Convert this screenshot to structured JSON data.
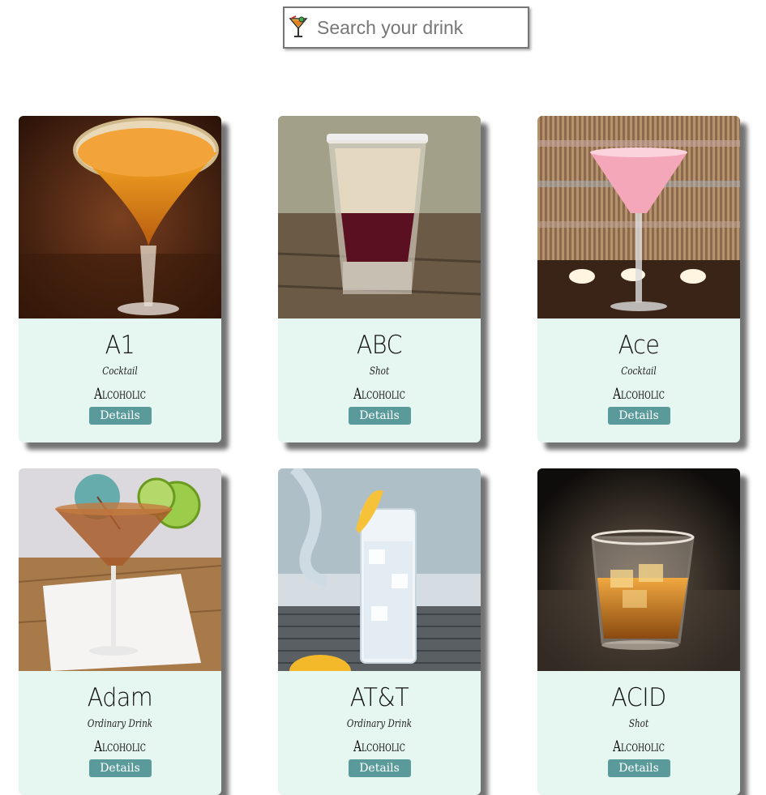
{
  "search": {
    "placeholder": "Search your drink",
    "icon": "cocktail-icon"
  },
  "drinks": [
    {
      "name": "A1",
      "category": "Cocktail",
      "alcoholic": "Alcoholic",
      "button": "Details"
    },
    {
      "name": "ABC",
      "category": "Shot",
      "alcoholic": "Alcoholic",
      "button": "Details"
    },
    {
      "name": "Ace",
      "category": "Cocktail",
      "alcoholic": "Alcoholic",
      "button": "Details"
    },
    {
      "name": "Adam",
      "category": "Ordinary Drink",
      "alcoholic": "Alcoholic",
      "button": "Details"
    },
    {
      "name": "AT&T",
      "category": "Ordinary Drink",
      "alcoholic": "Alcoholic",
      "button": "Details"
    },
    {
      "name": "ACID",
      "category": "Shot",
      "alcoholic": "Alcoholic",
      "button": "Details"
    }
  ],
  "colors": {
    "card_background": "#e6f6f0",
    "button": "#5a9a9a"
  }
}
